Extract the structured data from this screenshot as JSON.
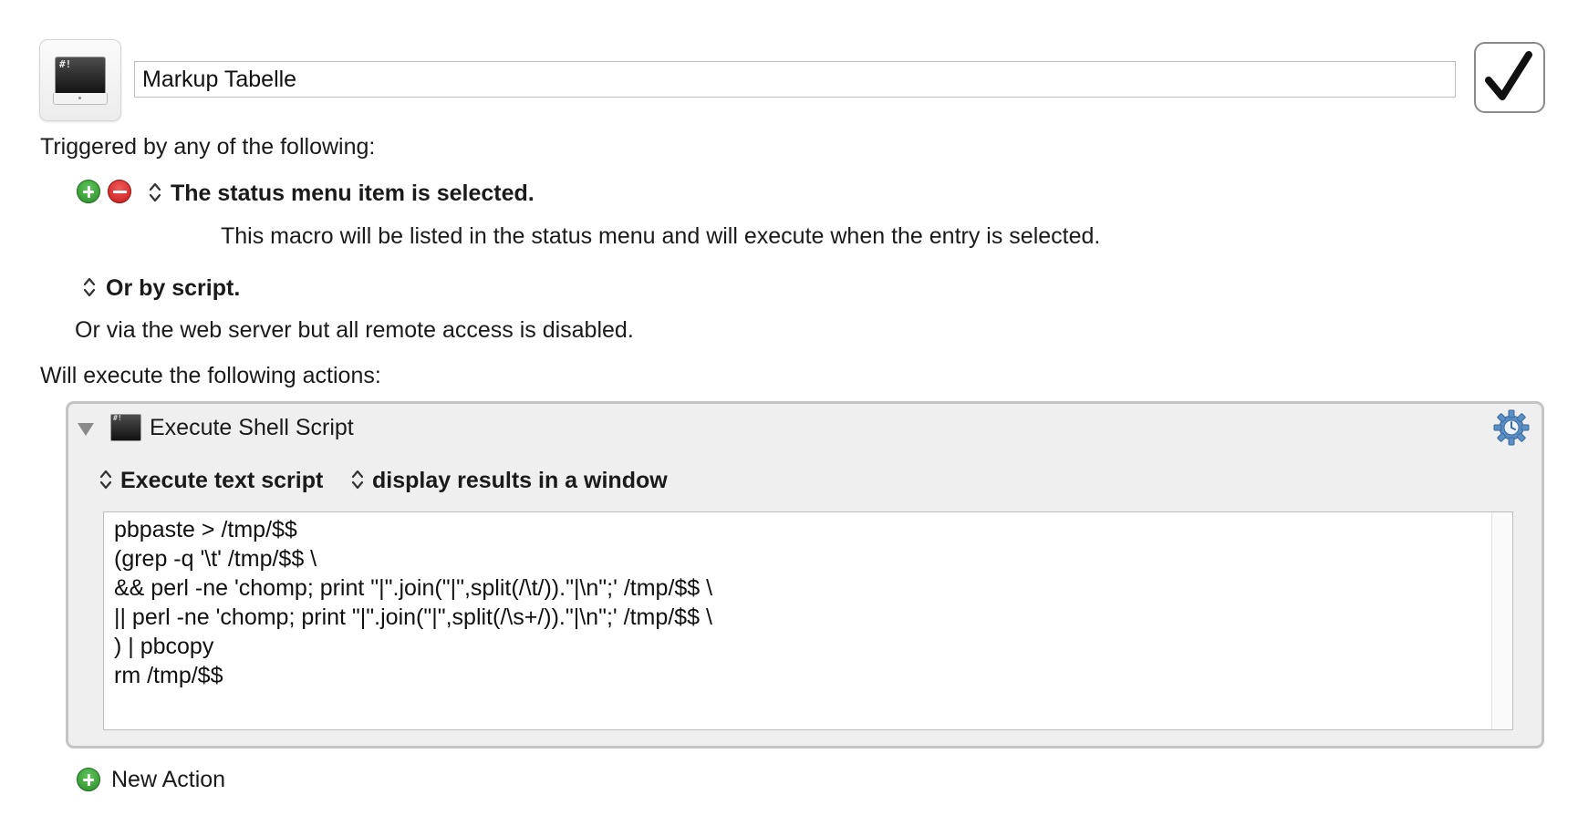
{
  "header": {
    "macro_icon": "terminal-shebang-icon",
    "shebang_label": "#!",
    "macro_name": "Markup Tabelle",
    "enabled_checkbox": "checkmark-icon"
  },
  "triggers": {
    "heading": "Triggered by any of the following:",
    "status_trigger_label": "The status menu item is selected.",
    "status_trigger_description": "This macro will be listed in the status menu and will execute when the entry is selected.",
    "script_trigger_label": "Or by script.",
    "web_server_text": "Or via the web server but all remote access is disabled."
  },
  "actions": {
    "heading": "Will execute the following actions:",
    "action_title": "Execute Shell Script",
    "action_icon_label": "#!",
    "script_mode": "Execute text script",
    "result_mode": "display results in a window",
    "script_lines": [
      "pbpaste > /tmp/$$",
      "(grep -q '\\t' /tmp/$$ \\",
      "&& perl -ne 'chomp; print \"|\".join(\"|\",split(/\\t/)).\"|\\n\";' /tmp/$$ \\",
      "|| perl -ne 'chomp; print \"|\".join(\"|\",split(/\\s+/)).\"|\\n\";' /tmp/$$ \\",
      ") | pbcopy",
      "rm /tmp/$$"
    ],
    "new_action_label": "New Action"
  },
  "colors": {
    "add_green": "#2b8a2b",
    "remove_red": "#c41a1a",
    "panel_gray": "#efefef",
    "gear_blue": "#5a8fc7"
  }
}
